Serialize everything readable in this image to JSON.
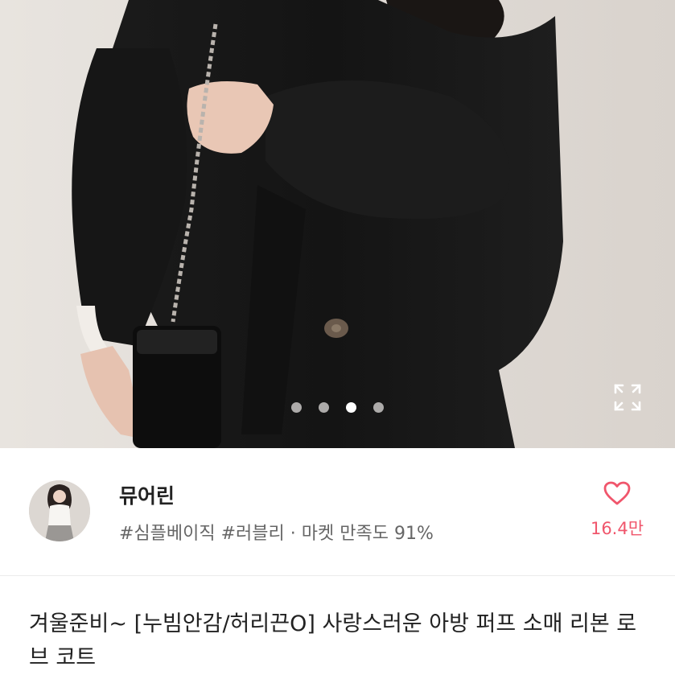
{
  "gallery": {
    "image_alt": "black robe coat product photo",
    "page_count": 4,
    "active_index": 2,
    "expand_icon": "expand-icon"
  },
  "seller": {
    "name": "뮤어린",
    "tags_line": "#심플베이직 #러블리 · 마켓 만족도 91%",
    "like_icon": "heart-outline-icon",
    "like_count": "16.4만",
    "accent_color": "#f0566c"
  },
  "product": {
    "title": "겨울준비~ [누빔안감/허리끈O] 사랑스러운 아방 퍼프 소매 리본 로브 코트"
  }
}
